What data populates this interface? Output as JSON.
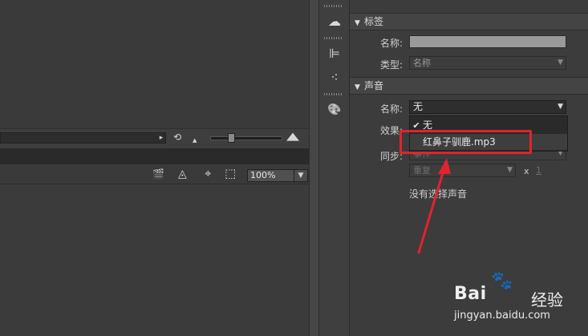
{
  "timeline": {
    "scroll_arrow": "▸",
    "rotate_icon": "⟲",
    "small_mountain": "▲",
    "large_mountain": "▲"
  },
  "toolbar": {
    "clapper_icon": "🎬",
    "pen_icon": "◬",
    "snap_icon": "⌖",
    "fit_icon": "⬚",
    "zoom_value": "100%",
    "zoom_arrow": "▼"
  },
  "dock": {
    "icons": [
      "creative-cloud-icon",
      "align-icon",
      "swatches-icon",
      "palette-icon"
    ],
    "glyphs": [
      "☁",
      "⊫",
      "⁖",
      "🎨"
    ]
  },
  "label_section": {
    "title": "标签",
    "name_label": "名称:",
    "type_label": "类型:",
    "type_value": "名称"
  },
  "sound_section": {
    "title": "声音",
    "name_label": "名称:",
    "name_value": "无",
    "effect_label": "效果:",
    "sync_label": "同步:",
    "sync_value": "事件",
    "repeat_value": "重复",
    "repeat_x": "x",
    "repeat_count": "1",
    "no_sound_text": "没有选择声音"
  },
  "dropdown": {
    "items": [
      {
        "label": "无",
        "checked": true
      },
      {
        "label": "红鼻子驯鹿.mp3",
        "checked": false
      }
    ],
    "check_glyph": "✔"
  },
  "colors": {
    "highlight": "#e0242e",
    "panel_bg": "#3c3c3c"
  },
  "watermark": {
    "brand_left": "Bai",
    "brand_paw": "🐾",
    "brand_right": "经验",
    "url": "jingyan.baidu.com"
  }
}
